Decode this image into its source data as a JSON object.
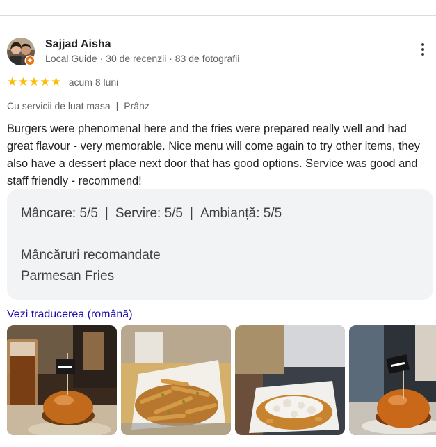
{
  "review": {
    "author": {
      "name": "Sajjad Aisha",
      "meta": "Local Guide · 30 de recenzii · 83 de fotografii",
      "badge_icon": "local-guide-star-icon"
    },
    "stars": "★★★★★",
    "rating": 5,
    "date": "acum 8 luni",
    "service": {
      "type": "Cu servicii de luat masa",
      "separator": "|",
      "meal": "Prânz"
    },
    "text": "Burgers were phenomenal here and the fries were prepared really well and had great flavour - very memorable. Nice menu will come again to try other items, they also have a dessert place next door that has good options. Service was good and staff friendly - recommend!",
    "details": {
      "food": "Mâncare: 5/5",
      "service": "Servire: 5/5",
      "atmosphere": "Ambianță: 5/5",
      "separator": "|",
      "recommended_title": "Mâncăruri recomandate",
      "recommended_dish": "Parmesan Fries"
    },
    "translate_link": "Vezi traducerea (română)",
    "more_icon": "more-vert-icon"
  },
  "colors": {
    "star": "#fbbc04",
    "link": "#1a0dab",
    "muted_text": "#5f6368",
    "card_bg": "#f1f3f4",
    "badge": "#e8710a"
  }
}
